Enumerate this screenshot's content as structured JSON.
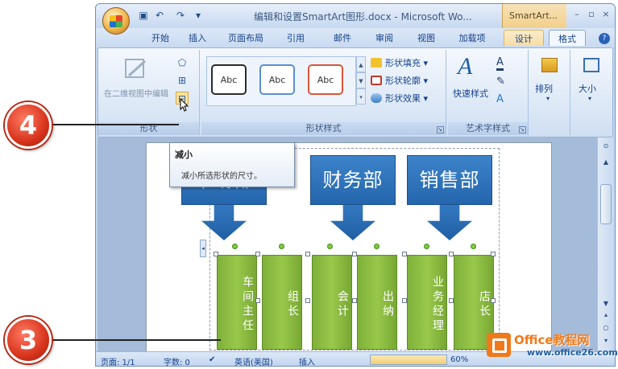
{
  "window": {
    "document_title": "编辑和设置SmartArt图形.docx - Microsoft Wo...",
    "context_tab_title": "SmartArt...",
    "minimize": "–",
    "restore": "▫",
    "close": "×"
  },
  "quick_access": {
    "save": "▣",
    "undo": "↶",
    "redo": "↷",
    "customize": "▾"
  },
  "tabs": [
    {
      "label": "开始"
    },
    {
      "label": "插入"
    },
    {
      "label": "页面布局"
    },
    {
      "label": "引用"
    },
    {
      "label": "邮件"
    },
    {
      "label": "审阅"
    },
    {
      "label": "视图"
    },
    {
      "label": "加载项"
    },
    {
      "label": "设计"
    },
    {
      "label": "格式"
    }
  ],
  "help": "?",
  "ribbon": {
    "shapes_group": {
      "label": "形状",
      "edit_in_2d_label": "在二维视图中编辑",
      "change_shape_icon": "⬠",
      "larger_icon": "⊞",
      "smaller_icon": "⊟"
    },
    "shape_styles_group": {
      "label": "形状样式",
      "style_samples": [
        "Abc",
        "Abc",
        "Abc"
      ],
      "style_colors": [
        "#2b2b2b",
        "#5b8fd0",
        "#d9553a"
      ],
      "fill_label": "形状填充",
      "outline_label": "形状轮廓",
      "effects_label": "形状效果"
    },
    "wordart_group": {
      "label": "艺术字样式",
      "quick_styles_label": "快速样式"
    },
    "arrange_label": "排列",
    "size_label": "大小"
  },
  "tooltip": {
    "title": "减小",
    "description": "减小所选形状的尺寸。"
  },
  "smartart": {
    "departments": [
      {
        "label": "市场部"
      },
      {
        "label": "财务部"
      },
      {
        "label": "销售部"
      }
    ],
    "members": [
      {
        "label": "车间主任"
      },
      {
        "label": "组长"
      },
      {
        "label": "会计"
      },
      {
        "label": "出纳"
      },
      {
        "label": "业务经理"
      },
      {
        "label": "店长"
      }
    ]
  },
  "status_bar": {
    "page": "页面: 1/1",
    "words": "字数: 0",
    "language": "英语(美国)",
    "insert_mode": "插入",
    "zoom": "60%"
  },
  "callouts": [
    "4",
    "3"
  ],
  "watermark": {
    "title": "Office教程网",
    "url": "www.office26.com"
  }
}
